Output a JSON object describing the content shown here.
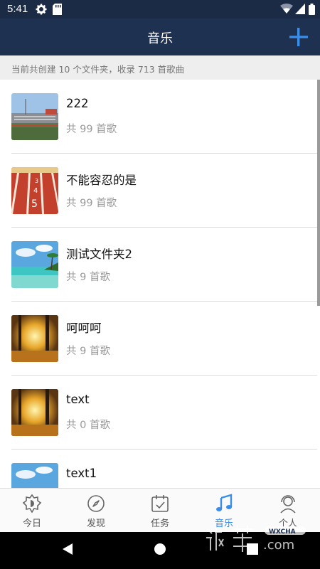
{
  "status": {
    "time": "5:41"
  },
  "header": {
    "title": "音乐"
  },
  "summary": "当前共创建 10 个文件夹，收录 713 首歌曲",
  "folders": [
    {
      "name": "222",
      "count": "共 99 首歌",
      "cover": "stadium"
    },
    {
      "name": "不能容忍的是",
      "count": "共 99 首歌",
      "cover": "running-track"
    },
    {
      "name": "测试文件夹2",
      "count": "共 9 首歌",
      "cover": "beach"
    },
    {
      "name": "呵呵呵",
      "count": "共 9 首歌",
      "cover": "autumn-forest"
    },
    {
      "name": "text",
      "count": "共 0 首歌",
      "cover": "autumn-forest"
    },
    {
      "name": "text1",
      "count": "",
      "cover": "beach"
    }
  ],
  "tabs": [
    {
      "label": "今日",
      "icon": "today-icon"
    },
    {
      "label": "发现",
      "icon": "compass-icon"
    },
    {
      "label": "任务",
      "icon": "calendar-check-icon"
    },
    {
      "label": "音乐",
      "icon": "music-note-icon",
      "active": true
    },
    {
      "label": "个人",
      "icon": "person-headset-icon"
    }
  ],
  "colors": {
    "header": "#1f3150",
    "statusbar": "#1b2a45",
    "accent": "#3a8de8"
  }
}
